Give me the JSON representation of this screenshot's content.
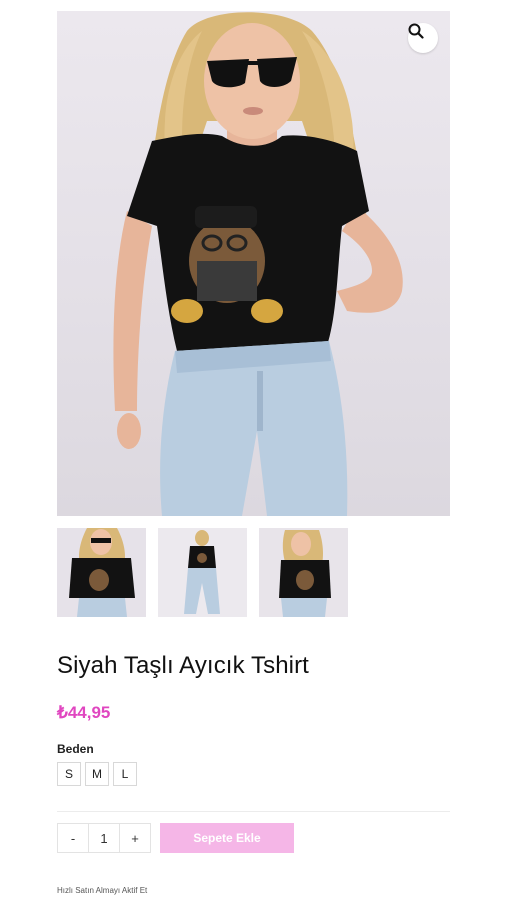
{
  "product": {
    "title": "Siyah Taşlı Ayıcık Tshirt",
    "price": "₺44,95",
    "image_alt": "model wearing black teddy bear t-shirt and light blue jeans",
    "zoom_icon": "search-icon"
  },
  "gallery": {
    "thumbnails": [
      "thumb-front",
      "thumb-full-body",
      "thumb-side"
    ]
  },
  "variations": {
    "size_label": "Beden",
    "sizes": [
      "S",
      "M",
      "L"
    ]
  },
  "cart": {
    "minus": "-",
    "quantity": "1",
    "plus": "+",
    "add_label": "Sepete Ekle"
  },
  "quick_buy": {
    "label": "Hızlı Satın Almayı Aktif Et"
  },
  "colors": {
    "price": "#e046c0",
    "button": "#f5b6e7"
  }
}
